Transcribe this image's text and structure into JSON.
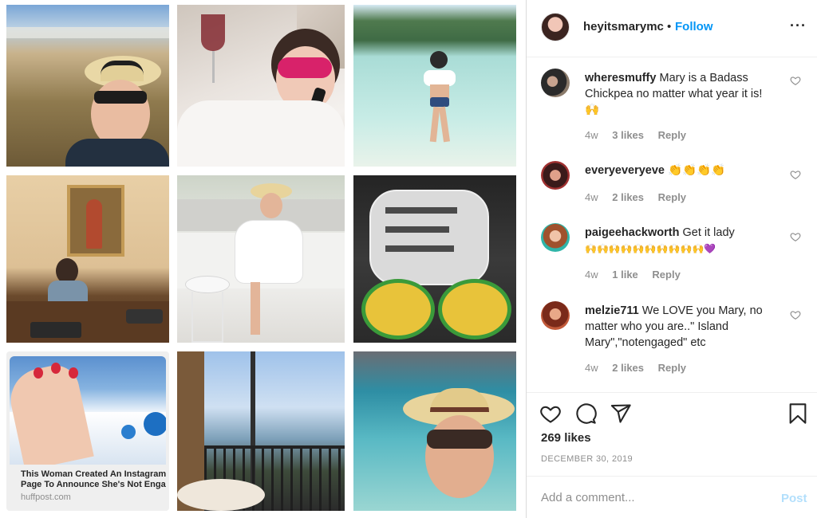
{
  "header": {
    "username": "heyitsmarymc",
    "separator": "•",
    "follow_label": "Follow",
    "more_label": "···"
  },
  "grid": {
    "link_preview": {
      "title_line1": "This Woman Created An Instagram",
      "title_line2": "Page To Announce She's Not Enga",
      "source": "huffpost.com"
    }
  },
  "comments": [
    {
      "username": "wheresmuffy",
      "text": "Mary is a Badass Chickpea no matter what year it is!",
      "emoji": "🙌",
      "age": "4w",
      "likes": "3 likes",
      "reply_label": "Reply"
    },
    {
      "username": "everyeveryeve",
      "text": "",
      "emoji": "👏👏👏👏",
      "age": "4w",
      "likes": "2 likes",
      "reply_label": "Reply"
    },
    {
      "username": "paigeehackworth",
      "text": "Get it lady",
      "emoji": "🙌🙌🙌🙌🙌🙌🙌🙌🙌🙌💜",
      "age": "4w",
      "likes": "1 like",
      "reply_label": "Reply"
    },
    {
      "username": "melzie711",
      "text": "We LOVE you Mary, no matter who you are..\" Island Mary\",\"notengaged\" etc",
      "emoji": "",
      "age": "4w",
      "likes": "2 likes",
      "reply_label": "Reply"
    }
  ],
  "post": {
    "likes": "269 likes",
    "date": "DECEMBER 30, 2019"
  },
  "add_comment": {
    "placeholder": "Add a comment...",
    "post_label": "Post"
  },
  "colors": {
    "link_blue": "#0095f6",
    "post_disabled": "#b2dffc",
    "muted": "#8e8e8e",
    "text": "#262626"
  }
}
